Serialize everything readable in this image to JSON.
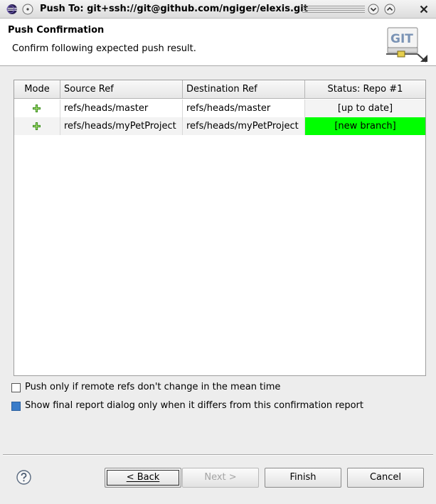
{
  "window": {
    "title": "Push To: git+ssh://git@github.com/ngiger/elexis.git"
  },
  "header": {
    "title": "Push Confirmation",
    "subtitle": "Confirm following expected push result.",
    "logo_text": "GIT"
  },
  "table": {
    "columns": [
      "Mode",
      "Source Ref",
      "Destination Ref",
      "Status: Repo #1"
    ],
    "rows": [
      {
        "mode_icon": "add-plus-icon",
        "source": "refs/heads/master",
        "destination": "refs/heads/master",
        "status": "[up to date]"
      },
      {
        "mode_icon": "add-plus-icon",
        "source": "refs/heads/myPetProject",
        "destination": "refs/heads/myPetProject",
        "status": "[new branch]"
      }
    ]
  },
  "options": {
    "push_only_if_unchanged": {
      "label": "Push only if remote refs don't change in the mean time",
      "checked": false
    },
    "show_final_report": {
      "label": "Show final report dialog only when it differs from this confirmation report",
      "checked": true
    }
  },
  "buttons": {
    "back": "< Back",
    "next": "Next >",
    "finish": "Finish",
    "cancel": "Cancel"
  },
  "colors": {
    "new_branch_status": "#00ff00",
    "checked_box": "#3a7cc9"
  }
}
